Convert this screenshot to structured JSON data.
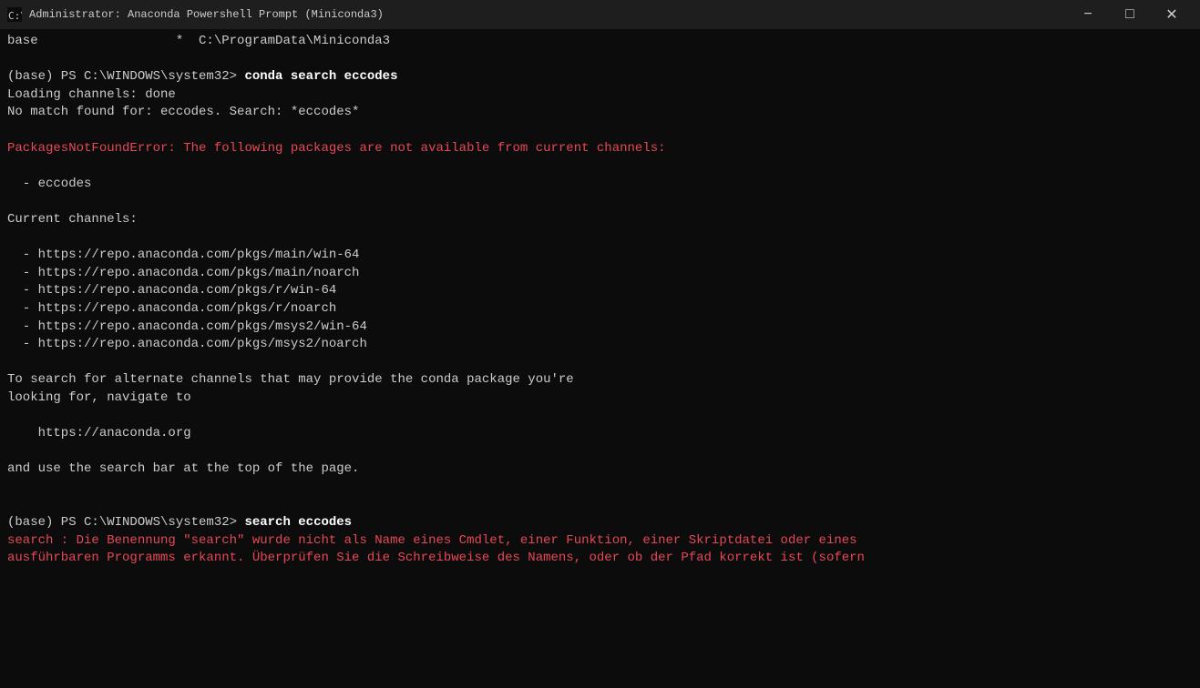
{
  "titleBar": {
    "icon": "terminal-icon",
    "title": "Administrator: Anaconda Powershell Prompt (Miniconda3)",
    "minimize": "−",
    "maximize": "□",
    "close": "✕"
  },
  "terminal": {
    "lines": [
      {
        "id": "l1",
        "type": "normal",
        "text": "base                  *  C:\\ProgramData\\Miniconda3"
      },
      {
        "id": "l2",
        "type": "blank",
        "text": ""
      },
      {
        "id": "l3",
        "type": "command",
        "prompt": "(base) PS C:\\WINDOWS\\system32> ",
        "cmd": "conda search eccodes"
      },
      {
        "id": "l4",
        "type": "normal",
        "text": "Loading channels: done"
      },
      {
        "id": "l5",
        "type": "normal",
        "text": "No match found for: eccodes. Search: *eccodes*"
      },
      {
        "id": "l6",
        "type": "blank",
        "text": ""
      },
      {
        "id": "l7",
        "type": "error",
        "text": "PackagesNotFoundError: The following packages are not available from current channels:"
      },
      {
        "id": "l8",
        "type": "blank",
        "text": ""
      },
      {
        "id": "l9",
        "type": "normal",
        "text": "  - eccodes"
      },
      {
        "id": "l10",
        "type": "blank",
        "text": ""
      },
      {
        "id": "l11",
        "type": "normal",
        "text": "Current channels:"
      },
      {
        "id": "l12",
        "type": "blank",
        "text": ""
      },
      {
        "id": "l13",
        "type": "normal",
        "text": "  - https://repo.anaconda.com/pkgs/main/win-64"
      },
      {
        "id": "l14",
        "type": "normal",
        "text": "  - https://repo.anaconda.com/pkgs/main/noarch"
      },
      {
        "id": "l15",
        "type": "normal",
        "text": "  - https://repo.anaconda.com/pkgs/r/win-64"
      },
      {
        "id": "l16",
        "type": "normal",
        "text": "  - https://repo.anaconda.com/pkgs/r/noarch"
      },
      {
        "id": "l17",
        "type": "normal",
        "text": "  - https://repo.anaconda.com/pkgs/msys2/win-64"
      },
      {
        "id": "l18",
        "type": "normal",
        "text": "  - https://repo.anaconda.com/pkgs/msys2/noarch"
      },
      {
        "id": "l19",
        "type": "blank",
        "text": ""
      },
      {
        "id": "l20",
        "type": "normal",
        "text": "To search for alternate channels that may provide the conda package you're"
      },
      {
        "id": "l21",
        "type": "normal",
        "text": "looking for, navigate to"
      },
      {
        "id": "l22",
        "type": "blank",
        "text": ""
      },
      {
        "id": "l23",
        "type": "normal",
        "text": "    https://anaconda.org"
      },
      {
        "id": "l24",
        "type": "blank",
        "text": ""
      },
      {
        "id": "l25",
        "type": "normal",
        "text": "and use the search bar at the top of the page."
      },
      {
        "id": "l26",
        "type": "blank",
        "text": ""
      },
      {
        "id": "l27",
        "type": "blank",
        "text": ""
      },
      {
        "id": "l28",
        "type": "command",
        "prompt": "(base) PS C:\\WINDOWS\\system32> ",
        "cmd": "search eccodes"
      },
      {
        "id": "l29",
        "type": "error",
        "text": "search : Die Benennung \"search\" wurde nicht als Name eines Cmdlet, einer Funktion, einer Skriptdatei oder eines"
      },
      {
        "id": "l30",
        "type": "error",
        "text": "ausführbaren Programms erkannt. Überprüfen Sie die Schreibweise des Namens, oder ob der Pfad korrekt ist (sofern"
      }
    ]
  }
}
